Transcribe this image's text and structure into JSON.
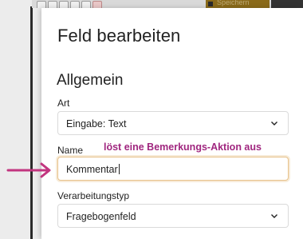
{
  "panel": {
    "title": "Feld bearbeiten",
    "section_title": "Allgemein"
  },
  "fields": {
    "art": {
      "label": "Art",
      "value": "Eingabe: Text"
    },
    "name": {
      "label": "Name",
      "value": "Kommentar"
    },
    "verarbeitungstyp": {
      "label": "Verarbeitungstyp",
      "value": "Fragebogenfeld"
    }
  },
  "annotation": {
    "text": "löst eine Bemerkungs-Aktion aus",
    "color": "#a0267f"
  },
  "background_toolbar": {
    "save_label": "Speichern"
  },
  "colors": {
    "focus_border": "#e7c18a",
    "arrow": "#c2357f"
  }
}
